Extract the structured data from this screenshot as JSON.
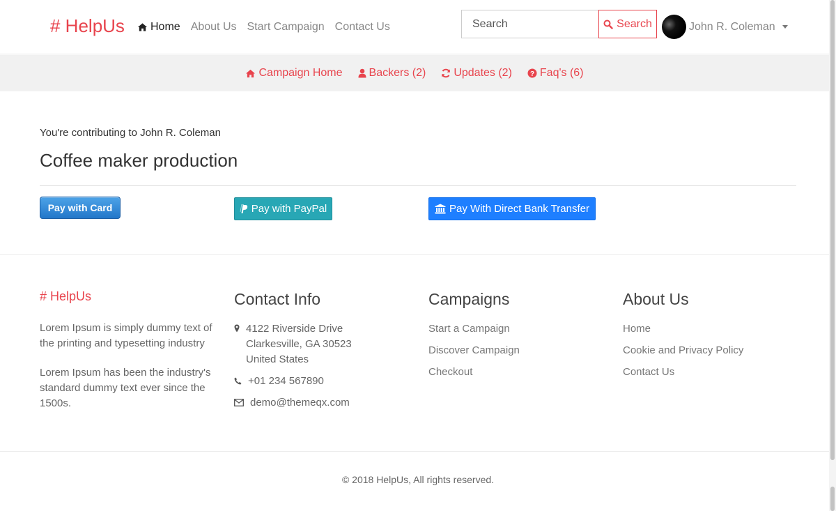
{
  "colors": {
    "brand": "#e8444d",
    "paypal": "#28a7b5",
    "bank": "#1e7fff",
    "card": "#2377c9"
  },
  "navbar": {
    "brand": "# HelpUs",
    "links": [
      {
        "label": "Home",
        "icon": "home-icon",
        "active": true
      },
      {
        "label": "About Us"
      },
      {
        "label": "Start Campaign"
      },
      {
        "label": "Contact Us"
      }
    ],
    "search": {
      "placeholder": "Search",
      "button_label": "Search"
    },
    "user": {
      "name": "John R. Coleman"
    }
  },
  "subnav": [
    {
      "label": "Campaign Home",
      "icon": "home-icon"
    },
    {
      "label": "Backers (2)",
      "icon": "user-icon"
    },
    {
      "label": "Updates (2)",
      "icon": "refresh-icon"
    },
    {
      "label": "Faq's (6)",
      "icon": "question-circle-icon"
    }
  ],
  "main": {
    "contributing_text": "You're contributing to John R. Coleman",
    "title": "Coffee maker production",
    "buttons": {
      "card": "Pay with Card",
      "paypal": "Pay with PayPal",
      "bank": "Pay With Direct Bank Transfer"
    }
  },
  "footer": {
    "brand": "# HelpUs",
    "about_p1": "Lorem Ipsum is simply dummy text of the printing and typesetting industry",
    "about_p2": "Lorem Ipsum has been the industry's standard dummy text ever since the 1500s.",
    "contact": {
      "heading": "Contact Info",
      "address_line1": "4122 Riverside Drive",
      "address_line2": "Clarkesville, GA 30523",
      "address_line3": "United States",
      "phone": "+01 234 567890",
      "email": "demo@themeqx.com"
    },
    "campaigns": {
      "heading": "Campaigns",
      "links": [
        "Start a Campaign",
        "Discover Campaign",
        "Checkout"
      ]
    },
    "about": {
      "heading": "About Us",
      "links": [
        "Home",
        "Cookie and Privacy Policy",
        "Contact Us"
      ]
    },
    "copyright": "© 2018 HelpUs, All rights reserved."
  }
}
